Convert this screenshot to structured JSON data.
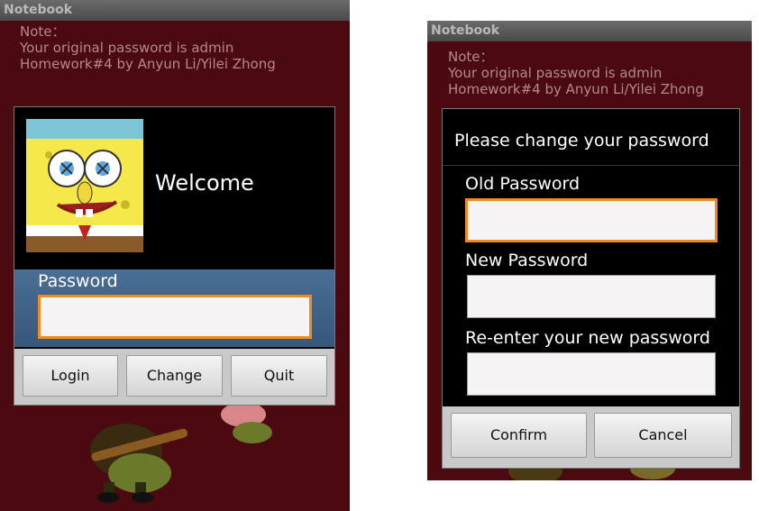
{
  "screen1": {
    "app_title": "Notebook",
    "note": [
      "Note：",
      "Your original password is admin",
      "Homework#4 by Anyun Li/Yilei Zhong"
    ],
    "welcome_text": "Welcome",
    "password_label": "Password",
    "password_value": "",
    "buttons": {
      "login": "Login",
      "change": "Change",
      "quit": "Quit"
    }
  },
  "screen2": {
    "app_title": "Notebook",
    "note": [
      "Note：",
      "Your original password is admin",
      "Homework#4 by Anyun Li/Yilei Zhong"
    ],
    "dialog_title": "Please change your password",
    "old_password_label": "Old Password",
    "new_password_label": "New Password",
    "reenter_label": "Re-enter your new password",
    "old_password_value": "",
    "new_password_value": "",
    "reenter_value": "",
    "buttons": {
      "confirm": "Confirm",
      "cancel": "Cancel"
    }
  },
  "colors": {
    "background": "#4a0a0f",
    "titlebar": "#595959",
    "note_text": "#b58a8a",
    "dialog": "#000000",
    "password_panel": "#3a5f85",
    "focus_border": "#f28a1e"
  },
  "icons": [
    "spongebob-avatar",
    "spongebob-background-art"
  ]
}
